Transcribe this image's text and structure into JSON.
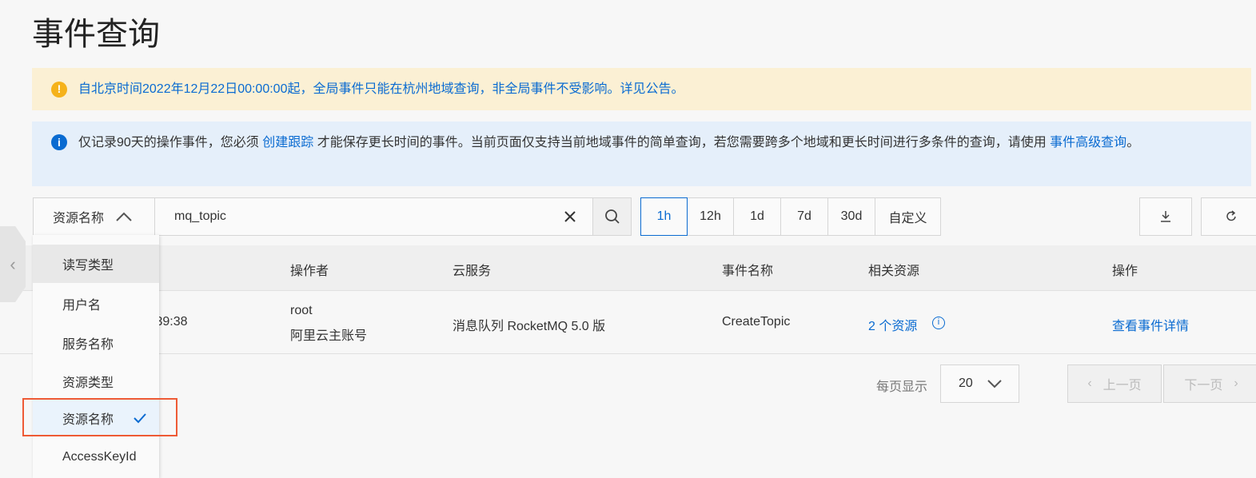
{
  "title": "事件查询",
  "notices": {
    "warning": "自北京时间2022年12月22日00:00:00起，全局事件只能在杭州地域查询，非全局事件不受影响。详见公告。",
    "info_pre": "仅记录90天的操作事件，您必须 ",
    "info_link1": "创建跟踪",
    "info_mid": " 才能保存更长时间的事件。当前页面仅支持当前地域事件的简单查询，若您需要跨多个地域和更长时间进行多条件的查询，请使用 ",
    "info_link2": "事件高级查询",
    "info_post": "。"
  },
  "filter": {
    "type_label": "资源名称",
    "search_value": "mq_topic"
  },
  "time_ranges": [
    "1h",
    "12h",
    "1d",
    "7d",
    "30d",
    "自定义"
  ],
  "selected_range": "1h",
  "table": {
    "headers": [
      "操作者",
      "云服务",
      "事件名称",
      "相关资源",
      "操作"
    ],
    "rows": [
      {
        "time": ":39:38",
        "operator": "root",
        "operator_type": "阿里云主账号",
        "service": "消息队列 RocketMQ 5.0 版",
        "event": "CreateTopic",
        "resources": "2 个资源",
        "action": "查看事件详情"
      }
    ]
  },
  "pagination": {
    "page_size_label": "每页显示",
    "page_size": "20",
    "prev": "上一页",
    "next": "下一页"
  },
  "dropdown": {
    "items": [
      "读写类型",
      "用户名",
      "服务名称",
      "资源类型",
      "资源名称",
      "AccessKeyId"
    ],
    "selected": "资源名称"
  }
}
